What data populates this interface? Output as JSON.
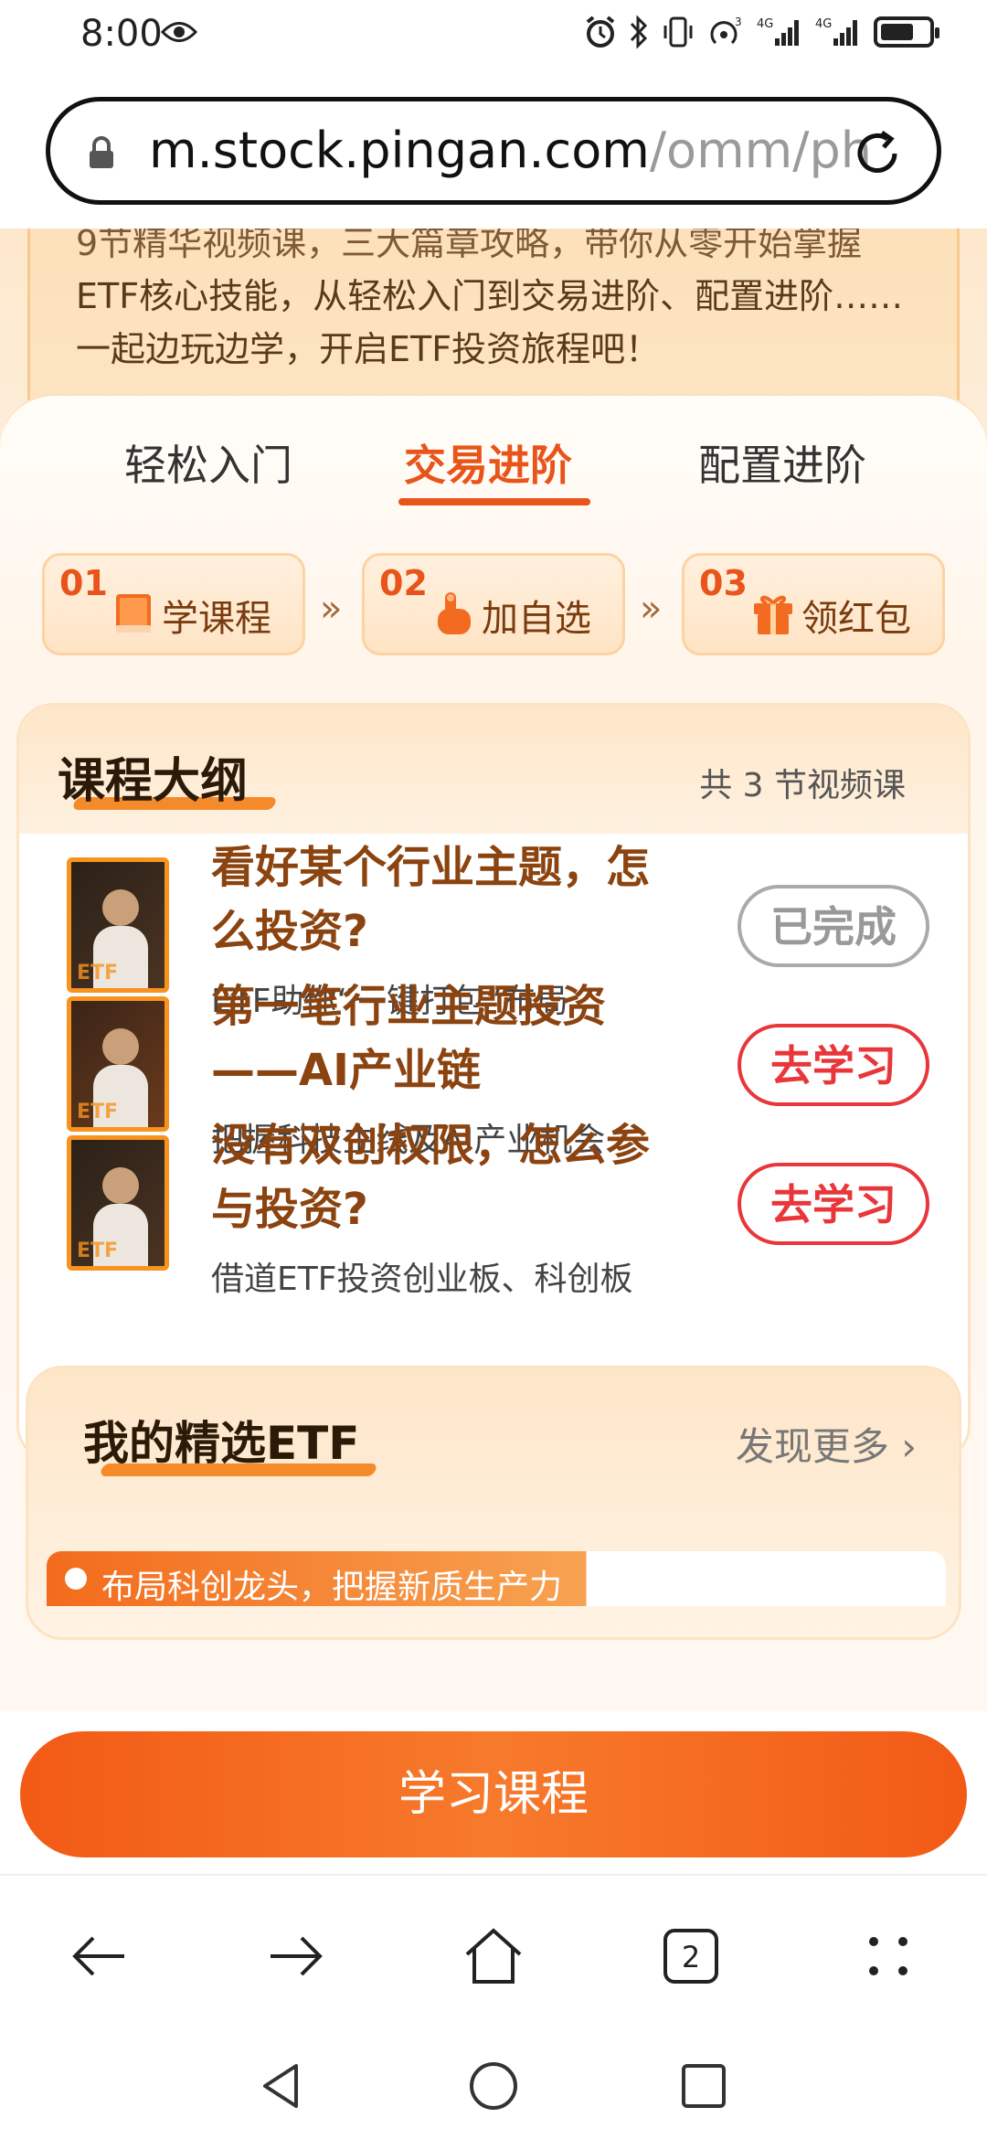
{
  "status_bar": {
    "time": "8:00",
    "network_label_1": "4G",
    "network_label_2": "4G",
    "battery_level": 0.7
  },
  "url_bar": {
    "host": "m.stock.pingan.com",
    "path": "/omm/ph"
  },
  "intro": {
    "line0": "9节精华视频课，三大篇章攻略，带你从零开始掌握",
    "line1": "ETF核心技能，从轻松入门到交易进阶、配置进阶……",
    "line2": "一起边玩边学，开启ETF投资旅程吧！"
  },
  "tabs": [
    {
      "label": "轻松入门",
      "active": false
    },
    {
      "label": "交易进阶",
      "active": true
    },
    {
      "label": "配置进阶",
      "active": false
    }
  ],
  "steps": [
    {
      "num": "01",
      "label": "学课程",
      "icon": "book-icon"
    },
    {
      "num": "02",
      "label": "加自选",
      "icon": "hand-tap-icon"
    },
    {
      "num": "03",
      "label": "领红包",
      "icon": "gift-icon"
    }
  ],
  "step_arrow": "»",
  "outline": {
    "title": "课程大纲",
    "count": "共 3 节视频课",
    "courses": [
      {
        "title": "看好某个行业主题，怎么投资?",
        "subtitle": "ETF助你“一键打包”布局",
        "button": "已完成",
        "status": "done"
      },
      {
        "title": "第一笔行业主题投资——AI产业链",
        "subtitle": "把握科技主线及AI产业机会",
        "button": "去学习",
        "status": "todo"
      },
      {
        "title": "没有双创权限，怎么参与投资?",
        "subtitle": "借道ETF投资创业板、科创板",
        "button": "去学习",
        "status": "todo"
      }
    ],
    "thumb_label": "ETF"
  },
  "etf_section": {
    "title": "我的精选ETF",
    "more": "发现更多",
    "banner_text": "布局科创龙头，把握新质生产力"
  },
  "cta": {
    "label": "学习课程"
  },
  "browser_nav": {
    "tab_count": "2"
  },
  "colors": {
    "accent": "#e8541a",
    "course_title": "#8b4310",
    "go_button": "#e8363a"
  }
}
